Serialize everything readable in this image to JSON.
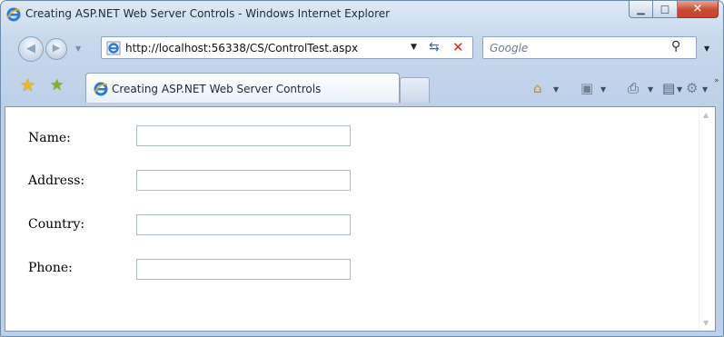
{
  "window": {
    "title": "Creating ASP.NET Web Server Controls - Windows Internet Explorer"
  },
  "titlebar": {
    "minimize_glyph": "▁",
    "maximize_glyph": "□",
    "close_glyph": "✕"
  },
  "address_bar": {
    "url": "http://localhost:56338/CS/ControlTest.aspx",
    "back_glyph": "◀",
    "forward_glyph": "▶",
    "dropdown_glyph": "▼",
    "refresh_glyph": "⇆",
    "stop_glyph": "✕"
  },
  "search": {
    "placeholder": "Google",
    "icon_glyph": "⚲"
  },
  "tabs": [
    {
      "label": "Creating ASP.NET Web Server Controls",
      "active": true
    }
  ],
  "toolbar": {
    "favorites_glyph": "★",
    "add_favorites_glyph": "★",
    "home_glyph": "⌂",
    "feeds_glyph": "▣",
    "print_glyph": "⎙",
    "page_glyph": "▤",
    "tools_glyph": "⚙",
    "more_glyph": "»",
    "dropdown_glyph": "▼"
  },
  "form": {
    "fields": [
      {
        "label": "Name:",
        "value": ""
      },
      {
        "label": "Address:",
        "value": ""
      },
      {
        "label": "Country:",
        "value": ""
      },
      {
        "label": "Phone:",
        "value": ""
      }
    ]
  },
  "scrollbar": {
    "up_glyph": "▲",
    "down_glyph": "▼"
  },
  "colors": {
    "close_button": "#c74a33",
    "refresh": "#2a6bc0",
    "stop": "#d62b1b",
    "favorites_star": "#f1b81a",
    "add_favorites_star": "#7ab52a"
  }
}
